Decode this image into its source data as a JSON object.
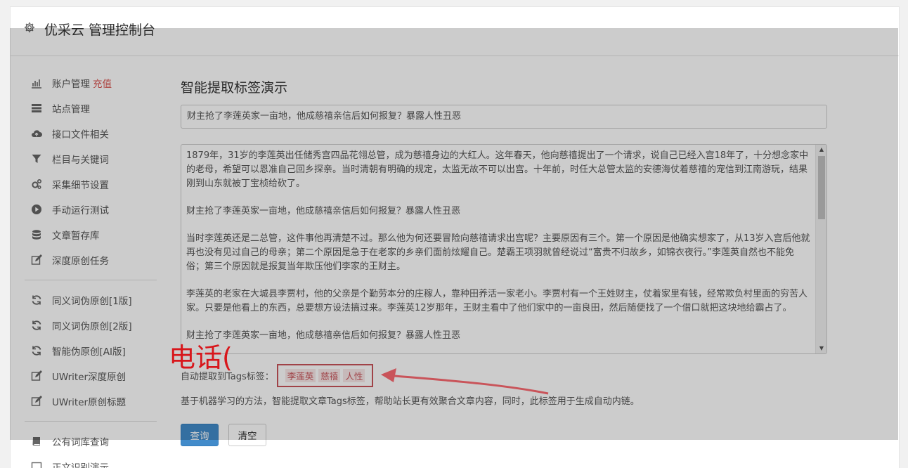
{
  "header": {
    "title": "优采云 管理控制台"
  },
  "sidebar": {
    "items": [
      {
        "label": "账户管理",
        "badge": "充值"
      },
      {
        "label": "站点管理"
      },
      {
        "label": "接口文件相关"
      },
      {
        "label": "栏目与关键词"
      },
      {
        "label": "采集细节设置"
      },
      {
        "label": "手动运行测试"
      },
      {
        "label": "文章暂存库"
      },
      {
        "label": "深度原创任务"
      },
      {
        "label": "同义词伪原创[1版]"
      },
      {
        "label": "同义词伪原创[2版]"
      },
      {
        "label": "智能伪原创[AI版]"
      },
      {
        "label": "UWriter深度原创"
      },
      {
        "label": "UWriter原创标题"
      },
      {
        "label": "公有词库查询"
      },
      {
        "label": "正文识别演示"
      }
    ]
  },
  "main": {
    "page_title": "智能提取标签演示",
    "title_value": "财主抢了李莲英家一亩地，他成慈禧亲信后如何报复？暴露人性丑恶",
    "body_paragraphs": [
      "1879年，31岁的李莲英出任储秀宫四品花翎总管，成为慈禧身边的大红人。这年春天，他向慈禧提出了一个请求，说自己已经入宫18年了，十分想念家中的老母，希望可以恩准自己回乡探亲。当时清朝有明确的规定，太监无故不可以出宫。十年前，时任大总管太监的安德海仗着慈禧的宠信到江南游玩，结果刚到山东就被丁宝桢给砍了。",
      "财主抢了李莲英家一亩地，他成慈禧亲信后如何报复？暴露人性丑恶",
      "当时李莲英还是二总管，这件事他再清楚不过。那么他为何还要冒险向慈禧请求出宫呢？主要原因有三个。第一个原因是他确实想家了，从13岁入宫后他就再也没有见过自己的母亲；第二个原因是急于在老家的乡亲们面前炫耀自己。楚霸王项羽就曾经说过“富贵不归故乡，如锦衣夜行。”李莲英自然也不能免俗；第三个原因就是报复当年欺压他们李家的王财主。",
      "李莲英的老家在大城县李贾村，他的父亲是个勤劳本分的庄稼人，靠种田养活一家老小。李贾村有一个王姓财主，仗着家里有钱，经常欺负村里面的穷苦人家。只要是他看上的东西，总要想方设法搞过来。李莲英12岁那年，王财主看中了他们家中的一亩良田，然后随便找了一个借口就把这块地给霸占了。",
      "财主抢了李莲英家一亩地，他成慈禧亲信后如何报复？暴露人性丑恶"
    ],
    "tags_label": "自动提取到Tags标签：",
    "tags": [
      "李莲英",
      "慈禧",
      "人性"
    ],
    "description": "基于机器学习的方法，智能提取文章Tags标签，帮助站长更有效聚合文章内容，同时，此标签用于生成自动内链。",
    "query_button": "查询",
    "clear_button": "清空"
  },
  "annotation": {
    "phone_text": "电话("
  },
  "colors": {
    "accent": "#428bca",
    "danger": "#d9534f",
    "annotation_red": "#d8161b",
    "tag_border": "#c9545a"
  }
}
